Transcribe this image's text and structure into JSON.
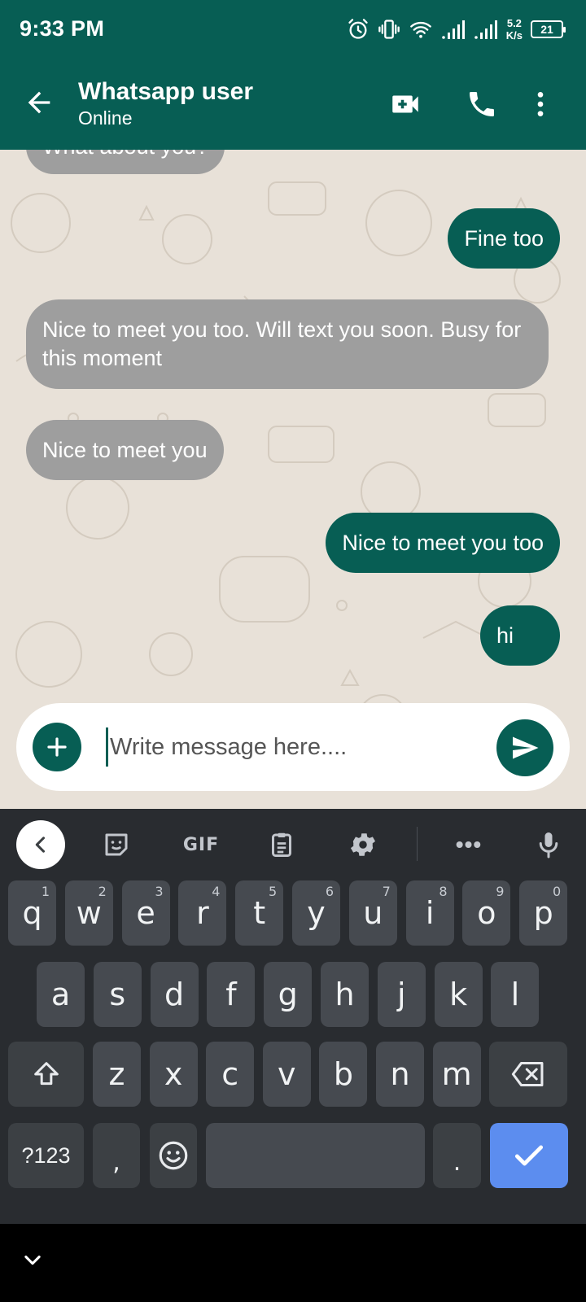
{
  "status_bar": {
    "time": "9:33 PM",
    "net_speed_value": "5.2",
    "net_speed_unit": "K/s",
    "battery": "21"
  },
  "header": {
    "contact_name": "Whatsapp user",
    "contact_status": "Online",
    "icons": [
      "back-arrow-icon",
      "video-call-icon",
      "phone-icon",
      "more-vert-icon"
    ]
  },
  "messages": [
    {
      "text": "What about you?",
      "direction": "incoming"
    },
    {
      "text": "Fine too",
      "direction": "outgoing"
    },
    {
      "text": "Nice to meet you too. Will text you soon. Busy for this moment",
      "direction": "incoming"
    },
    {
      "text": "Nice to meet you",
      "direction": "incoming"
    },
    {
      "text": "Nice to meet you too",
      "direction": "outgoing"
    },
    {
      "text": "hi",
      "direction": "outgoing"
    }
  ],
  "composer": {
    "placeholder": "Write message here....",
    "value": ""
  },
  "keyboard": {
    "toolbar": {
      "gif_label": "GIF",
      "more_label": "•••"
    },
    "row1": [
      {
        "char": "q",
        "hint": "1"
      },
      {
        "char": "w",
        "hint": "2"
      },
      {
        "char": "e",
        "hint": "3"
      },
      {
        "char": "r",
        "hint": "4"
      },
      {
        "char": "t",
        "hint": "5"
      },
      {
        "char": "y",
        "hint": "6"
      },
      {
        "char": "u",
        "hint": "7"
      },
      {
        "char": "i",
        "hint": "8"
      },
      {
        "char": "o",
        "hint": "9"
      },
      {
        "char": "p",
        "hint": "0"
      }
    ],
    "row2": [
      "a",
      "s",
      "d",
      "f",
      "g",
      "h",
      "j",
      "k",
      "l"
    ],
    "row3": [
      "z",
      "x",
      "c",
      "v",
      "b",
      "n",
      "m"
    ],
    "symbols_label": "?123",
    "comma_label": ",",
    "period_label": "."
  },
  "colors": {
    "brand": "#075e54",
    "incoming_bubble": "#9e9e9e",
    "chat_background": "#e8e1d8",
    "keyboard_bg": "#292c30",
    "key": "#464a50",
    "enter_key": "#5c8def"
  }
}
